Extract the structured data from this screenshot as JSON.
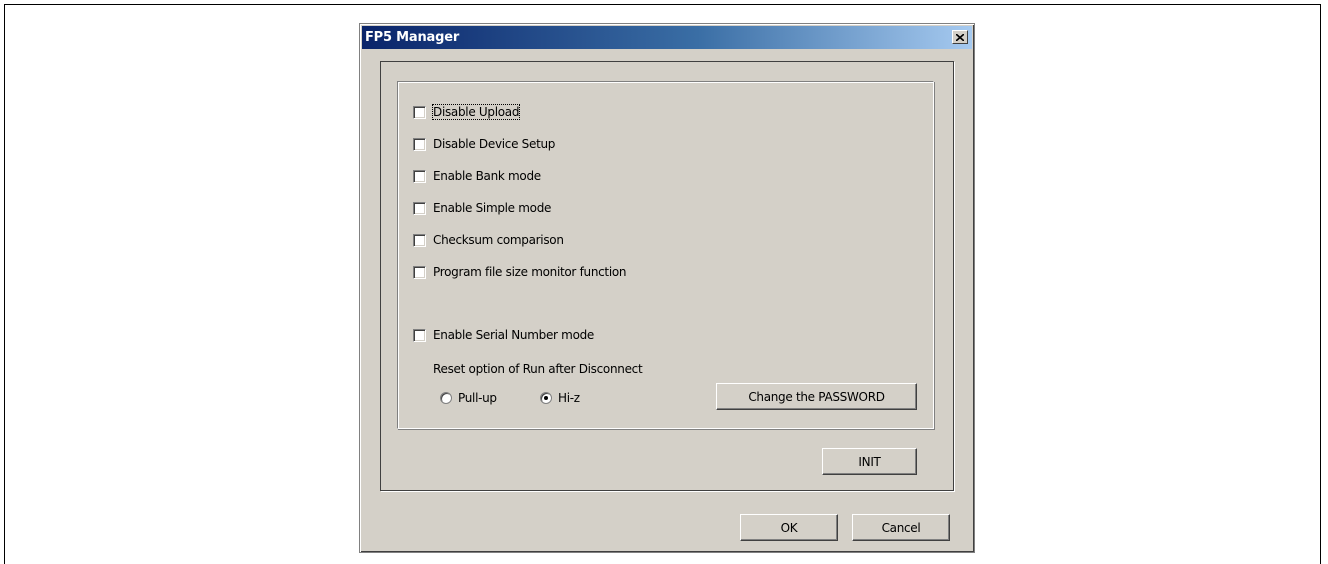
{
  "dialog": {
    "title": "FP5 Manager",
    "close_glyph": "✕"
  },
  "options": [
    {
      "label": "Disable Upload",
      "checked": false,
      "focused": true
    },
    {
      "label": "Disable Device Setup",
      "checked": false
    },
    {
      "label": "Enable Bank mode",
      "checked": false
    },
    {
      "label": "Enable Simple mode",
      "checked": false
    },
    {
      "label": "Checksum comparison",
      "checked": false
    },
    {
      "label": "Program file size monitor function",
      "checked": false
    },
    {
      "label": "Enable Serial Number mode",
      "checked": false
    }
  ],
  "reset_option": {
    "label": "Reset option of Run after Disconnect",
    "choices": [
      {
        "label": "Pull-up",
        "selected": false
      },
      {
        "label": "Hi-z",
        "selected": true
      }
    ]
  },
  "buttons": {
    "change_password": "Change the PASSWORD",
    "init": "INIT",
    "ok": "OK",
    "cancel": "Cancel"
  }
}
